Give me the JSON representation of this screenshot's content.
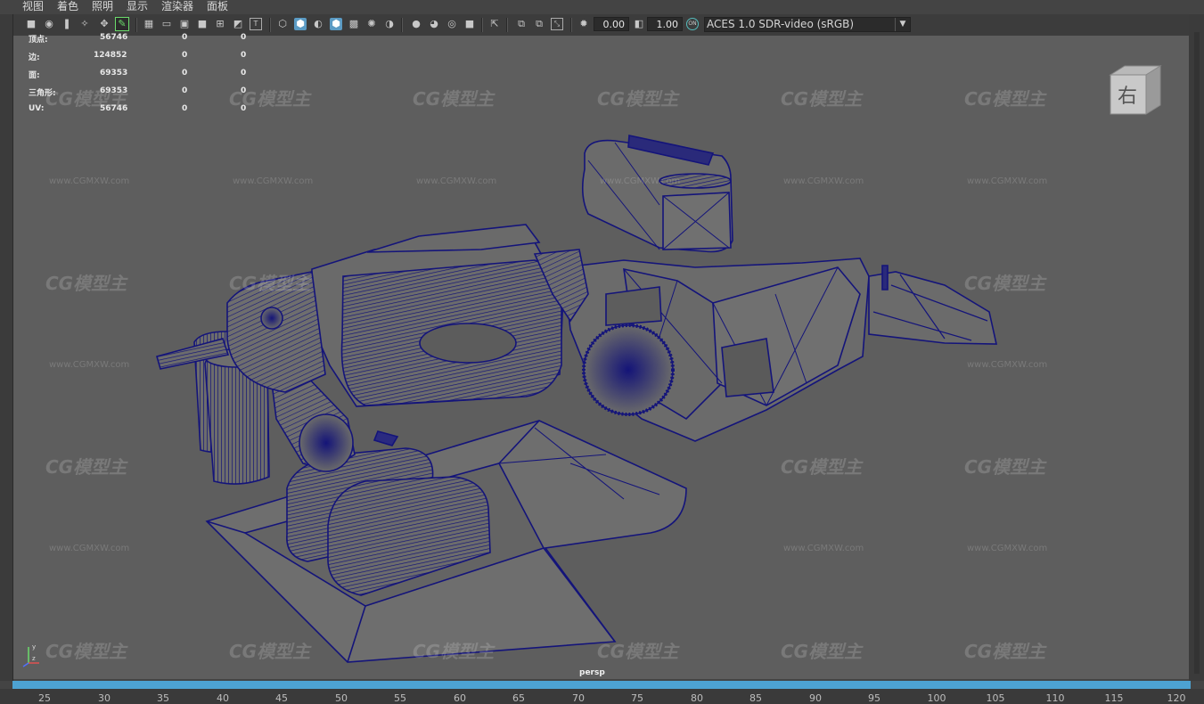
{
  "menu": [
    "视图",
    "着色",
    "照明",
    "显示",
    "渲染器",
    "面板"
  ],
  "toolbar": {
    "value_a": "0.00",
    "value_b": "1.00",
    "color_space": "ACES 1.0 SDR-video (sRGB)",
    "icons": [
      "camera-icon",
      "camera-attr-icon",
      "bookmark-icon",
      "image-plane-icon",
      "grid-icon",
      "film-gate-icon",
      "resolution-gate-icon",
      "gate-mask-icon",
      "field-chart-icon",
      "safe-action-icon",
      "safe-title-icon",
      "wireframe-icon",
      "smooth-shade-icon",
      "textured-icon",
      "lights-icon",
      "shadows-icon",
      "ambient-occlusion-icon",
      "isolate-select-icon",
      "xray-icon",
      "xray-joints-icon",
      "backface-icon",
      "colorspace-icon",
      "aces-icon"
    ]
  },
  "hud": {
    "rows": [
      {
        "label": "顶点:",
        "v1": "56746",
        "v2": "0",
        "v3": "0"
      },
      {
        "label": "边:",
        "v1": "124852",
        "v2": "0",
        "v3": "0"
      },
      {
        "label": "面:",
        "v1": "69353",
        "v2": "0",
        "v3": "0"
      },
      {
        "label": "三角形:",
        "v1": "69353",
        "v2": "0",
        "v3": "0"
      },
      {
        "label": "UV:",
        "v1": "56746",
        "v2": "0",
        "v3": "0"
      }
    ]
  },
  "viewcube": {
    "face_label": "右"
  },
  "camera": "persp",
  "watermark": {
    "logo": "CG模型主",
    "url": "www.CGMXW.com"
  },
  "timeline": {
    "ticks": [
      "25",
      "30",
      "35",
      "40",
      "45",
      "50",
      "55",
      "60",
      "65",
      "70",
      "75",
      "80",
      "85",
      "90",
      "95",
      "100",
      "105",
      "110",
      "115",
      "120"
    ]
  },
  "colors": {
    "wire": "#14147a",
    "viewport_bg": "#5e5e5e",
    "timeline_accent": "#4da2d2"
  }
}
